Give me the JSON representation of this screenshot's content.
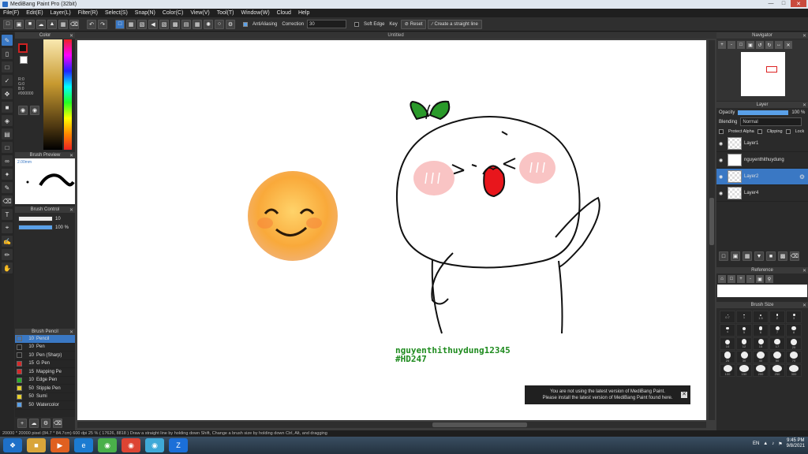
{
  "window": {
    "title": "MediBang Paint Pro (32bit)"
  },
  "menu": [
    "File(F)",
    "Edit(E)",
    "Layer(L)",
    "Filter(R)",
    "Select(S)",
    "Snap(N)",
    "Color(C)",
    "View(V)",
    "Tool(T)",
    "Window(W)",
    "Cloud",
    "Help"
  ],
  "toolbar": {
    "antialiasing_label": "AntiAliasing",
    "correction_label": "Correction",
    "correction_value": "30",
    "soft_edge_label": "Soft Edge",
    "key_label": "Key",
    "reset_label": "Reset",
    "straight_line_label": "Create a straight line"
  },
  "color_panel": {
    "title": "Color",
    "rgb": [
      "R:0",
      "G:0",
      "B:0"
    ],
    "hex": "#000000"
  },
  "brush_preview": {
    "title": "Brush Preview",
    "size_label": "2.00mm"
  },
  "brush_control": {
    "title": "Brush Control",
    "size_value": "10",
    "opacity_value": "100 %"
  },
  "brush_list": {
    "title": "Brush Pencil",
    "items": [
      {
        "size": "10",
        "name": "Pencil",
        "color": "#3a78c4",
        "selected": true
      },
      {
        "size": "10",
        "name": "Pen",
        "color": "#222222"
      },
      {
        "size": "10",
        "name": "Pen (Sharp)",
        "color": "#222222"
      },
      {
        "size": "15",
        "name": "G Pen",
        "color": "#d42a2a"
      },
      {
        "size": "15",
        "name": "Mapping Pe",
        "color": "#d42a2a"
      },
      {
        "size": "10",
        "name": "Edge Pen",
        "color": "#2ab02a"
      },
      {
        "size": "50",
        "name": "Stipple Pen",
        "color": "#e8d12a"
      },
      {
        "size": "50",
        "name": "Sumi",
        "color": "#e8d12a"
      },
      {
        "size": "50",
        "name": "Watercolor",
        "color": "#5aa0e8"
      }
    ]
  },
  "document": {
    "tab": "Untitled"
  },
  "watermark": {
    "line1": "nguyenthithuydung12345",
    "line2": "#HD247"
  },
  "notice": {
    "line1": "You are not using the latest version of MediBang Paint.",
    "line2": "Please install the latest version of MediBang Paint found here."
  },
  "navigator": {
    "title": "Navigator"
  },
  "layer_panel": {
    "title": "Layer",
    "opacity_label": "Opacity",
    "opacity_value": "100 %",
    "blending_label": "Blending",
    "blending_value": "Normal",
    "protect_alpha": "Protect Alpha",
    "clipping": "Clipping",
    "lock": "Lock",
    "layers": [
      {
        "name": "Layer1",
        "selected": false
      },
      {
        "name": "nguyenthithuydung",
        "selected": false
      },
      {
        "name": "Layer2",
        "selected": true
      },
      {
        "name": "Layer4",
        "selected": false
      }
    ]
  },
  "reference": {
    "title": "Reference"
  },
  "brush_size": {
    "title": "Brush Size",
    "sizes": [
      "0.7",
      "1",
      "1.5",
      "2",
      "3",
      "4",
      "5",
      "6",
      "7",
      "8",
      "10",
      "12",
      "15",
      "17",
      "20",
      "25",
      "30",
      "40",
      "50",
      "70",
      "100",
      "150",
      "200",
      "250",
      "300"
    ]
  },
  "status": {
    "text": "20000 * 20000 pixel   (84.7 * 84.7cm)   600 dpi   25 %   ( 17626, 8818 )   Draw a straight line by holding down Shift, Change a brush size by holding down Ctrl, Alt, and dragging"
  },
  "taskbar": {
    "lang": "EN",
    "time": "9:45 PM",
    "date": "9/8/2021"
  }
}
